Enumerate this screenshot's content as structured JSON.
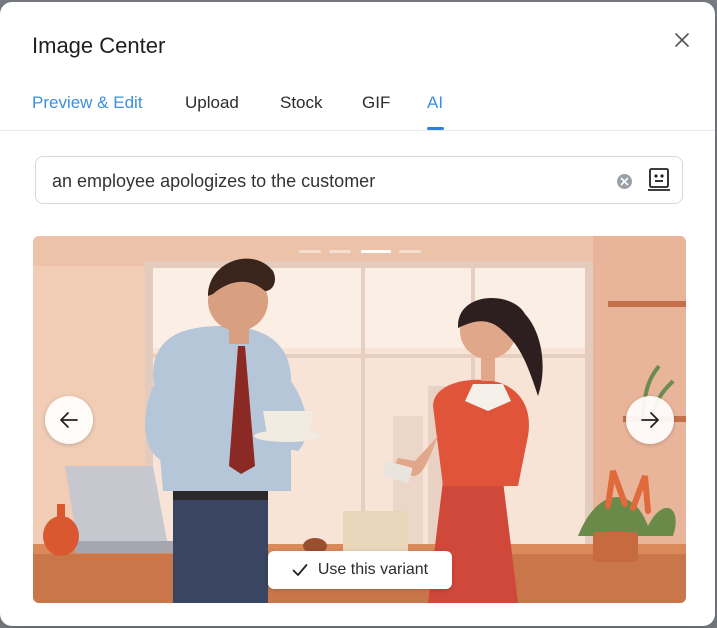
{
  "dialog": {
    "title": "Image Center",
    "close_icon": "close-icon"
  },
  "tabs": [
    {
      "label": "Preview & Edit",
      "active": false
    },
    {
      "label": "Upload",
      "active": false
    },
    {
      "label": "Stock",
      "active": false
    },
    {
      "label": "GIF",
      "active": false
    },
    {
      "label": "AI",
      "active": true
    }
  ],
  "search": {
    "value": "an employee apologizes to the customer",
    "clear_icon": "clear-circle-icon",
    "action_icon": "robot-face-icon"
  },
  "carousel": {
    "prev_icon": "arrow-left-icon",
    "next_icon": "arrow-right-icon",
    "slide_count": 4,
    "active_slide": 3,
    "use_variant_label": "Use this variant",
    "use_variant_icon": "check-icon"
  },
  "colors": {
    "accent": "#3a8fe0",
    "tab_underline": "#2f7fdc"
  }
}
